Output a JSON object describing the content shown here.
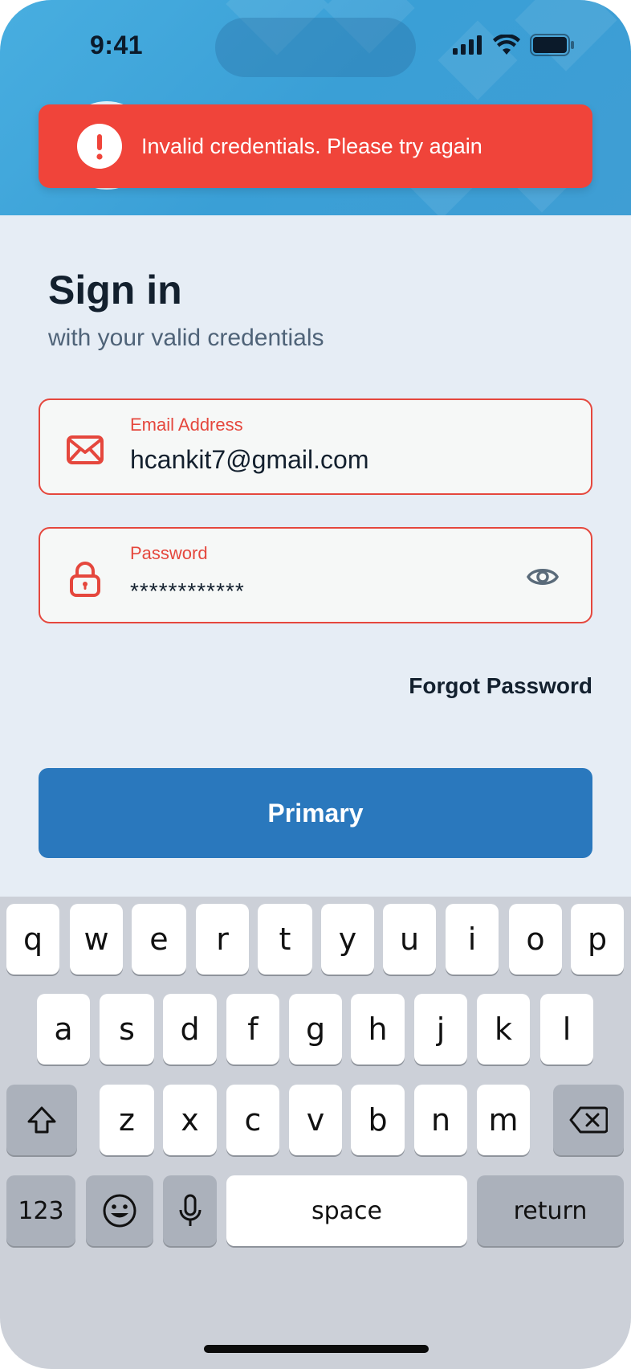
{
  "status_bar": {
    "time": "9:41"
  },
  "toast": {
    "message": "Invalid credentials. Please try again",
    "icon": "exclamation-icon"
  },
  "signin": {
    "title": "Sign in",
    "subtitle": "with your valid credentials",
    "email": {
      "label": "Email Address",
      "value": "hcankit7@gmail.com",
      "icon": "mail-icon"
    },
    "password": {
      "label": "Password",
      "value": "************",
      "icon": "lock-icon",
      "toggle_icon": "eye-icon"
    },
    "forgot_label": "Forgot Password",
    "primary_label": "Primary"
  },
  "keyboard": {
    "row1": [
      "q",
      "w",
      "e",
      "r",
      "t",
      "y",
      "u",
      "i",
      "o",
      "p"
    ],
    "row2": [
      "a",
      "s",
      "d",
      "f",
      "g",
      "h",
      "j",
      "k",
      "l"
    ],
    "row3": [
      "z",
      "x",
      "c",
      "v",
      "b",
      "n",
      "m"
    ],
    "numbers_label": "123",
    "space_label": "space",
    "return_label": "return"
  },
  "colors": {
    "header": "#3fa4da",
    "error": "#f0443a",
    "primary": "#2a78bd",
    "background": "#e6edf5",
    "keyboard": "#ccd0d8"
  }
}
